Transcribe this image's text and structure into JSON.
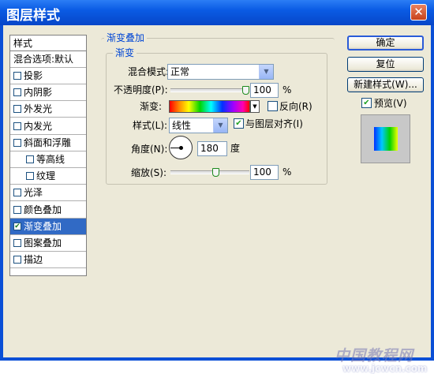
{
  "window": {
    "title": "图层样式",
    "close": "✕"
  },
  "list": {
    "header": "样式",
    "blend_options": "混合选项:默认",
    "items": [
      {
        "label": "投影",
        "checked": false,
        "selected": false,
        "indent": 0
      },
      {
        "label": "内阴影",
        "checked": false,
        "selected": false,
        "indent": 0
      },
      {
        "label": "外发光",
        "checked": false,
        "selected": false,
        "indent": 0
      },
      {
        "label": "内发光",
        "checked": false,
        "selected": false,
        "indent": 0
      },
      {
        "label": "斜面和浮雕",
        "checked": false,
        "selected": false,
        "indent": 0
      },
      {
        "label": "等高线",
        "checked": false,
        "selected": false,
        "indent": 1
      },
      {
        "label": "纹理",
        "checked": false,
        "selected": false,
        "indent": 1
      },
      {
        "label": "光泽",
        "checked": false,
        "selected": false,
        "indent": 0
      },
      {
        "label": "颜色叠加",
        "checked": false,
        "selected": false,
        "indent": 0
      },
      {
        "label": "渐变叠加",
        "checked": true,
        "selected": true,
        "indent": 0
      },
      {
        "label": "图案叠加",
        "checked": false,
        "selected": false,
        "indent": 0
      },
      {
        "label": "描边",
        "checked": false,
        "selected": false,
        "indent": 0
      }
    ]
  },
  "panel": {
    "outer_legend": "渐变叠加",
    "inner_legend": "渐变",
    "blend_mode_label": "混合模式:",
    "blend_mode_value": "正常",
    "opacity_label": "不透明度(P):",
    "opacity_value": "100",
    "opacity_level": 1.0,
    "percent": "%",
    "gradient_label": "渐变:",
    "reverse_label": "反向(R)",
    "reverse_checked": false,
    "style_label": "样式(L):",
    "style_value": "线性",
    "align_label": "与图层对齐(I)",
    "align_checked": true,
    "angle_label": "角度(N):",
    "angle_value": "180",
    "angle_unit": "度",
    "scale_label": "缩放(S):",
    "scale_value": "100",
    "scale_level": 0.57
  },
  "buttons": {
    "ok": "确定",
    "reset": "复位",
    "new_style": "新建样式(W)...",
    "preview_label": "预览(V)",
    "preview_checked": true
  },
  "watermark": {
    "line1": "中国教程网",
    "line2": "www.jcwcn.com"
  },
  "colors": {
    "title_blue": "#0a5be4",
    "select_blue": "#316ac5",
    "legend_blue": "#0046d5",
    "face": "#ece9d8"
  }
}
